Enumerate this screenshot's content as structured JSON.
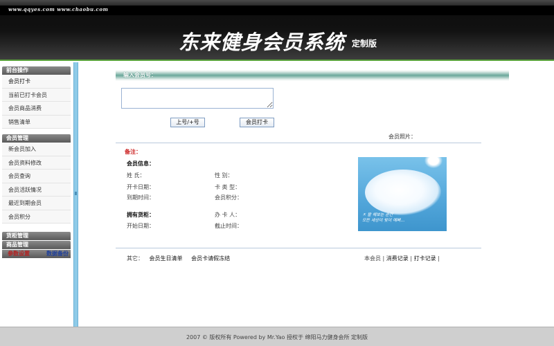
{
  "header": {
    "urls": "www.qqyes.com   www.chaobu.com",
    "title": "东来健身会员系统",
    "edition": "定制版"
  },
  "sidebar": {
    "sections": [
      {
        "title": "前台操作",
        "items": [
          "会员打卡",
          "当前已打卡会员",
          "会员商品消费",
          "销售清单"
        ]
      },
      {
        "title": "会员管理",
        "items": [
          "新会员加入",
          "会员资料修改",
          "会员查询",
          "会员活跃情况",
          "最近到期会员",
          "会员积分"
        ]
      }
    ],
    "cabinet": "货柜管理",
    "goods": "商品管理",
    "params": "参数设置",
    "backup": "数据备份"
  },
  "main": {
    "bar_label": "输入会员号：",
    "card_input_value": "",
    "btn_number": "上号/+号",
    "btn_checkin": "会员打卡",
    "photo_label": "会员照片：",
    "remark": "备注：",
    "member_info": "会员信息：",
    "name_label": "姓  氏：",
    "type_label": "性  别：",
    "open_date": "开卡日期：",
    "card_type": "卡 类 型：",
    "expire_date": "到期时间：",
    "points": "会员积分：",
    "cabinet_title": "拥有货柜：",
    "handler": "办 卡 人：",
    "start_date": "开始日期：",
    "end_time": "截止时间：",
    "photo_text_line1": "ㅈ 왈 해보는 순간",
    "photo_text_line2": "모든 세상이 빛이 예뻐..."
  },
  "footer_links": {
    "other": "其它：",
    "birthday": "会员生日清单",
    "freeze": "会员卡请假冻结",
    "this_member": "本会员 |",
    "consume": "消费记录",
    "sep": "|",
    "checkin_rec": "打卡记录",
    "sep2": "|"
  },
  "footer": {
    "text": "2007 © 版权所有  Powered by Mr.Yao  授权于  绵阳马力健身会所  定制版"
  }
}
